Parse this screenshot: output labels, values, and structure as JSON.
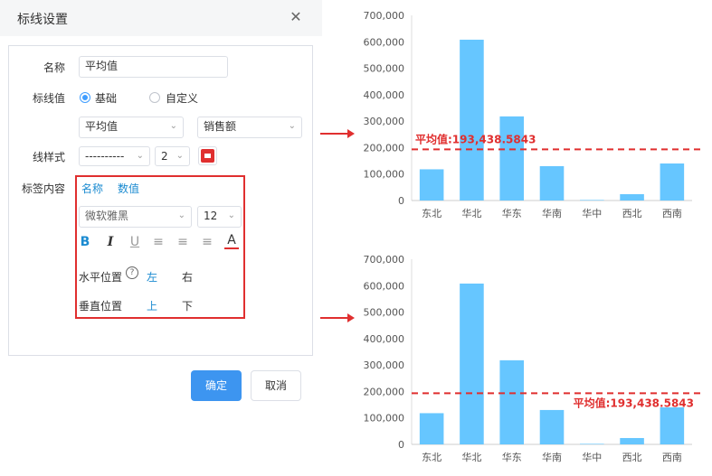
{
  "dialog": {
    "title": "标线设置",
    "close_icon": "close-icon",
    "name_label": "名称",
    "name_value": "平均值",
    "value_label": "标线值",
    "radio_basic": "基础",
    "radio_custom": "自定义",
    "calc_select": "平均值",
    "field_select": "销售额",
    "style_label": "线样式",
    "line_dash": "----------",
    "line_width": "2",
    "line_color": "#e02f2f",
    "content_label": "标签内容",
    "tag_name": "名称",
    "tag_value": "数值",
    "font_select": "微软雅黑",
    "font_size": "12",
    "fmt": {
      "bold": "B",
      "italic": "I",
      "underline": "U",
      "font_color": "A"
    },
    "h_pos_label": "水平位置",
    "h_left": "左",
    "h_right": "右",
    "v_pos_label": "垂直位置",
    "v_top": "上",
    "v_bottom": "下",
    "ok": "确定",
    "cancel": "取消"
  },
  "chart_data": [
    {
      "type": "bar",
      "categories": [
        "东北",
        "华北",
        "华东",
        "华南",
        "华中",
        "西北",
        "西南"
      ],
      "values": [
        118000,
        608000,
        318000,
        130000,
        2000,
        24000,
        140000
      ],
      "ylim": [
        0,
        700000
      ],
      "yticks": [
        "0",
        "100,000",
        "200,000",
        "300,000",
        "400,000",
        "500,000",
        "600,000",
        "700,000"
      ],
      "ref_line": {
        "value": 193438.5843,
        "label": "平均值:193,438.5843",
        "label_position": "left-top"
      },
      "bar_color": "#66c6ff"
    },
    {
      "type": "bar",
      "categories": [
        "东北",
        "华北",
        "华东",
        "华南",
        "华中",
        "西北",
        "西南"
      ],
      "values": [
        118000,
        608000,
        318000,
        130000,
        2000,
        24000,
        140000
      ],
      "ylim": [
        0,
        700000
      ],
      "yticks": [
        "0",
        "100,000",
        "200,000",
        "300,000",
        "400,000",
        "500,000",
        "600,000",
        "700,000"
      ],
      "ref_line": {
        "value": 193438.5843,
        "label": "平均值:193,438.5843",
        "label_position": "right-bottom"
      },
      "bar_color": "#66c6ff"
    }
  ]
}
